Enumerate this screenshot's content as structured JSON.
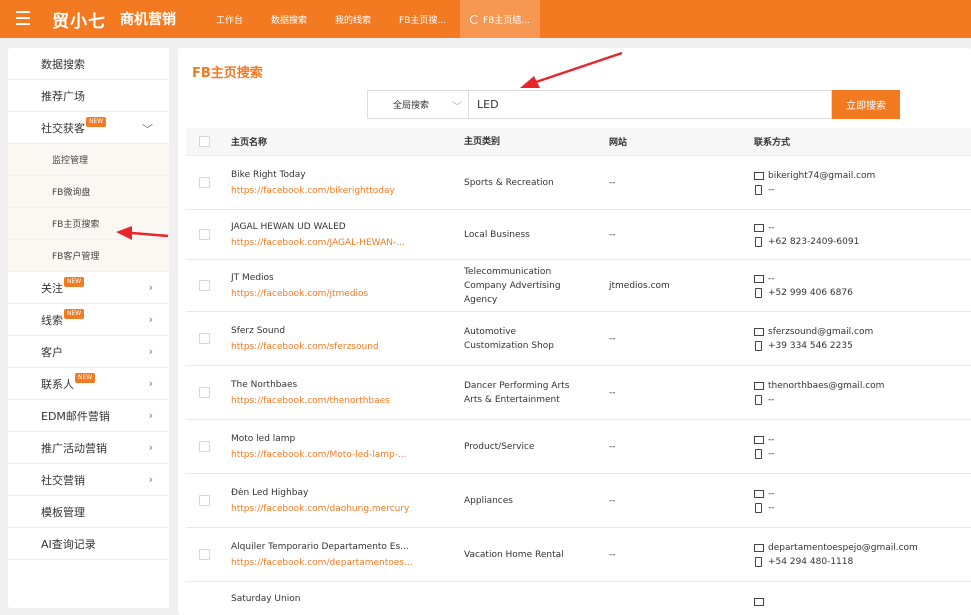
{
  "header": {
    "brand": "贸小七",
    "subtitle": "商机营销",
    "nav": [
      {
        "label": "工作台"
      },
      {
        "label": "数据搜索"
      },
      {
        "label": "我的线索"
      },
      {
        "label": "FB主页搜..."
      },
      {
        "label": "FB主页结..."
      }
    ]
  },
  "sidebar": {
    "items": [
      {
        "label": "数据搜索"
      },
      {
        "label": "推荐广场"
      },
      {
        "label": "社交获客",
        "badge": "NEW"
      },
      {
        "label": "监控管理"
      },
      {
        "label": "FB微询盘"
      },
      {
        "label": "FB主页搜索"
      },
      {
        "label": "FB客户管理"
      },
      {
        "label": "关注",
        "badge": "NEW"
      },
      {
        "label": "线索",
        "badge": "NEW"
      },
      {
        "label": "客户"
      },
      {
        "label": "联系人",
        "badge": "NEW"
      },
      {
        "label": "EDM邮件营销"
      },
      {
        "label": "推广活动营销"
      },
      {
        "label": "社交营销"
      },
      {
        "label": "模板管理"
      },
      {
        "label": "AI查询记录"
      }
    ]
  },
  "main": {
    "title": "FB主页搜索",
    "search": {
      "scope": "全局搜索",
      "value": "LED",
      "button": "立即搜索"
    },
    "columns": [
      "主页名称",
      "主页类别",
      "网站",
      "联系方式"
    ],
    "rows": [
      {
        "name": "Bike Right Today",
        "url": "https://facebook.com/bikerighttoday",
        "cat1": "Sports & Recreation",
        "cat2": "",
        "cat3": "",
        "site": "--",
        "email": "bikeright74@gmail.com",
        "phone": "--"
      },
      {
        "name": "JAGAL HEWAN UD WALED",
        "url": "https://facebook.com/JAGAL-HEWAN-...",
        "cat1": "Local Business",
        "cat2": "",
        "cat3": "",
        "site": "--",
        "email": "--",
        "phone": "+62 823-2409-6091"
      },
      {
        "name": "JT Medios",
        "url": "https://facebook.com/jtmedios",
        "cat1": "Telecommunication",
        "cat2": "Company Advertising",
        "cat3": "Agency",
        "site": "jtmedios.com",
        "email": "--",
        "phone": "+52 999 406 6876"
      },
      {
        "name": "Sferz Sound",
        "url": "https://facebook.com/sferzsound",
        "cat1": "Automotive",
        "cat2": "Customization Shop",
        "cat3": "",
        "site": "--",
        "email": "sferzsound@gmail.com",
        "phone": "+39 334 546 2235"
      },
      {
        "name": "The Northbaes",
        "url": "https://facebook.com/thenorthbaes",
        "cat1": "Dancer Performing Arts",
        "cat2": "Arts & Entertainment",
        "cat3": "",
        "site": "--",
        "email": "thenorthbaes@gmail.com",
        "phone": "--"
      },
      {
        "name": "Moto led lamp",
        "url": "https://facebook.com/Moto-led-lamp-...",
        "cat1": "Product/Service",
        "cat2": "",
        "cat3": "",
        "site": "--",
        "email": "--",
        "phone": "--"
      },
      {
        "name": "Đèn Led Highbay",
        "url": "https://facebook.com/daohung.mercury",
        "cat1": "Appliances",
        "cat2": "",
        "cat3": "",
        "site": "--",
        "email": "--",
        "phone": "--"
      },
      {
        "name": "Alquiler Temporario Departamento Es...",
        "url": "https://facebook.com/departamentoes...",
        "cat1": "Vacation Home Rental",
        "cat2": "",
        "cat3": "",
        "site": "--",
        "email": "departamentoespejo@gmail.com",
        "phone": "+54 294 480-1118"
      },
      {
        "name": "Saturday Union",
        "url": "",
        "cat1": "",
        "cat2": "",
        "cat3": "",
        "site": "",
        "email": "",
        "phone": ""
      }
    ]
  },
  "colors": {
    "accent": "#f47a22",
    "annotation": "#e8262a"
  }
}
